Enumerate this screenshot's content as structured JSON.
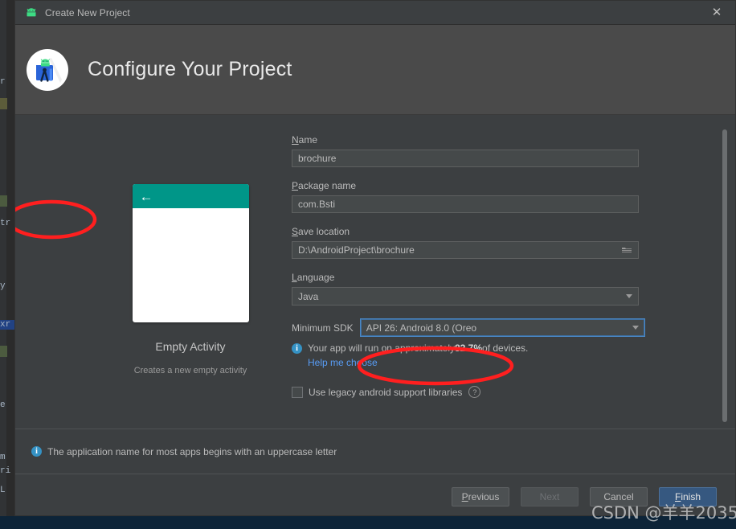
{
  "window": {
    "title": "Create New Project",
    "icon": "android-icon",
    "close_label": "✕"
  },
  "header": {
    "title": "Configure Your Project",
    "logo": "android-studio-logo"
  },
  "preview": {
    "back_arrow": "←",
    "title": "Empty Activity",
    "description": "Creates a new empty activity"
  },
  "form": {
    "name": {
      "label": "Name",
      "mnemonic": "N",
      "label_rest": "ame",
      "value": "brochure"
    },
    "package_name": {
      "label": "Package name",
      "mnemonic": "P",
      "label_rest": "ackage name",
      "value": "com.Bsti"
    },
    "save_location": {
      "label": "Save location",
      "mnemonic": "S",
      "label_rest": "ave location",
      "value": "D:\\AndroidProject\\brochure",
      "browse_icon": "folder-icon"
    },
    "language": {
      "label": "Language",
      "mnemonic": "L",
      "label_rest": "anguage",
      "value": "Java"
    },
    "minimum_sdk": {
      "label": "Minimum SDK",
      "value": "API 26: Android 8.0 (Oreo",
      "info_icon": "info-icon",
      "info_text_before": "Your app will run on approximately ",
      "info_percent": "82.7%",
      "info_text_after": " of devices.",
      "help_link": "Help me choose"
    },
    "legacy_checkbox": {
      "label": "Use legacy android support libraries",
      "checked": false,
      "help_icon": "question-icon"
    }
  },
  "footer": {
    "info_icon": "info-icon",
    "message": "The application name for most apps begins with an uppercase letter",
    "buttons": {
      "previous": {
        "label": "Previous",
        "mnemonic": "P",
        "rest": "revious",
        "enabled": true
      },
      "next": {
        "label": "Next",
        "enabled": false
      },
      "cancel": {
        "label": "Cancel",
        "enabled": true
      },
      "finish": {
        "label": "Finish",
        "mnemonic": "F",
        "rest": "inish",
        "enabled": true,
        "primary": true
      }
    }
  },
  "watermark": "CSDN @羊羊2035",
  "colors": {
    "dialog_bg": "#3c3f41",
    "header_bg": "#4a4a4a",
    "input_bg": "#45494a",
    "accent_blue": "#365880",
    "focus_blue": "#4a88c7",
    "link_blue": "#589df6",
    "teal": "#009688",
    "annotation_red": "#ff1f1f",
    "ide_bg": "#2b2b2b",
    "status_bar": "#0d2438"
  },
  "background_ide": {
    "fragments": [
      "r",
      "tr",
      "y",
      "xr",
      "e",
      "m",
      "ri",
      "L"
    ]
  }
}
